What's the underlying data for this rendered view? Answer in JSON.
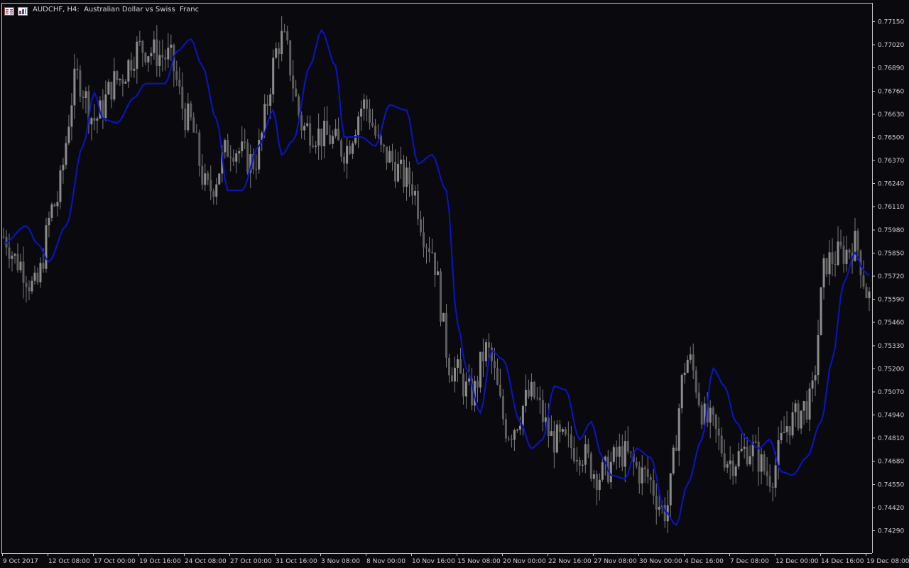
{
  "window": {
    "title": "AUDCHF, H4:  Australian Dollar vs Swiss  Franc",
    "icons": [
      "chart-window-icon",
      "chart-properties-icon"
    ]
  },
  "colors": {
    "background": "#0a0a0e",
    "candle": "#7a7a7a",
    "indicator": "#0a14c8",
    "axis": "#c8c8c8",
    "text": "#d0d0d0"
  },
  "chart_data": {
    "type": "line",
    "symbol": "AUDCHF",
    "timeframe": "H4",
    "description": "Australian Dollar vs Swiss  Franc",
    "price_axis_labels": [
      "0.77150",
      "0.77020",
      "0.76890",
      "0.76760",
      "0.76630",
      "0.76500",
      "0.76370",
      "0.76240",
      "0.76110",
      "0.75980",
      "0.75850",
      "0.75720",
      "0.75590",
      "0.75460",
      "0.75330",
      "0.75200",
      "0.75070",
      "0.74940",
      "0.74810",
      "0.74680",
      "0.74550",
      "0.74420",
      "0.74290"
    ],
    "time_axis_labels": [
      "9 Oct 2017",
      "12 Oct 08:00",
      "17 Oct 00:00",
      "19 Oct 16:00",
      "24 Oct 08:00",
      "27 Oct 00:00",
      "31 Oct 16:00",
      "3 Nov 08:00",
      "8 Nov 00:00",
      "10 Nov 16:00",
      "15 Nov 08:00",
      "20 Nov 00:00",
      "22 Nov 16:00",
      "27 Nov 08:00",
      "30 Nov 00:00",
      "4 Dec 16:00",
      "7 Dec 08:00",
      "12 Dec 00:00",
      "14 Dec 16:00",
      "19 Dec 08:00"
    ],
    "ylim": [
      0.7424,
      0.7722
    ],
    "price_keypoints": [
      {
        "t": 0,
        "p": 0.7594
      },
      {
        "t": 5,
        "p": 0.758
      },
      {
        "t": 11,
        "p": 0.7565
      },
      {
        "t": 18,
        "p": 0.7612
      },
      {
        "t": 26,
        "p": 0.7683
      },
      {
        "t": 32,
        "p": 0.766
      },
      {
        "t": 40,
        "p": 0.7682
      },
      {
        "t": 48,
        "p": 0.77
      },
      {
        "t": 58,
        "p": 0.7695
      },
      {
        "t": 65,
        "p": 0.766
      },
      {
        "t": 72,
        "p": 0.762
      },
      {
        "t": 80,
        "p": 0.7645
      },
      {
        "t": 88,
        "p": 0.7636
      },
      {
        "t": 98,
        "p": 0.7705
      },
      {
        "t": 106,
        "p": 0.7655
      },
      {
        "t": 114,
        "p": 0.765
      },
      {
        "t": 120,
        "p": 0.7643
      },
      {
        "t": 127,
        "p": 0.7668
      },
      {
        "t": 134,
        "p": 0.764
      },
      {
        "t": 143,
        "p": 0.7625
      },
      {
        "t": 150,
        "p": 0.759
      },
      {
        "t": 158,
        "p": 0.752
      },
      {
        "t": 165,
        "p": 0.7505
      },
      {
        "t": 170,
        "p": 0.753
      },
      {
        "t": 178,
        "p": 0.7485
      },
      {
        "t": 186,
        "p": 0.7505
      },
      {
        "t": 194,
        "p": 0.748
      },
      {
        "t": 202,
        "p": 0.7475
      },
      {
        "t": 210,
        "p": 0.746
      },
      {
        "t": 218,
        "p": 0.7472
      },
      {
        "t": 226,
        "p": 0.746
      },
      {
        "t": 233,
        "p": 0.744
      },
      {
        "t": 241,
        "p": 0.7525
      },
      {
        "t": 248,
        "p": 0.749
      },
      {
        "t": 256,
        "p": 0.7468
      },
      {
        "t": 263,
        "p": 0.7475
      },
      {
        "t": 270,
        "p": 0.746
      },
      {
        "t": 277,
        "p": 0.749
      },
      {
        "t": 284,
        "p": 0.75
      },
      {
        "t": 290,
        "p": 0.758
      },
      {
        "t": 296,
        "p": 0.7585
      },
      {
        "t": 300,
        "p": 0.759
      },
      {
        "t": 305,
        "p": 0.756
      }
    ],
    "indicator_keypoints": [
      {
        "t": 0,
        "p": 0.759
      },
      {
        "t": 8,
        "p": 0.76
      },
      {
        "t": 12,
        "p": 0.759
      },
      {
        "t": 16,
        "p": 0.758
      },
      {
        "t": 22,
        "p": 0.76
      },
      {
        "t": 28,
        "p": 0.7645
      },
      {
        "t": 32,
        "p": 0.7675
      },
      {
        "t": 35,
        "p": 0.766
      },
      {
        "t": 40,
        "p": 0.7658
      },
      {
        "t": 46,
        "p": 0.7672
      },
      {
        "t": 50,
        "p": 0.768
      },
      {
        "t": 57,
        "p": 0.768
      },
      {
        "t": 61,
        "p": 0.7698
      },
      {
        "t": 66,
        "p": 0.7705
      },
      {
        "t": 70,
        "p": 0.769
      },
      {
        "t": 75,
        "p": 0.766
      },
      {
        "t": 79,
        "p": 0.762
      },
      {
        "t": 84,
        "p": 0.762
      },
      {
        "t": 90,
        "p": 0.7645
      },
      {
        "t": 95,
        "p": 0.7665
      },
      {
        "t": 98,
        "p": 0.764
      },
      {
        "t": 102,
        "p": 0.7648
      },
      {
        "t": 108,
        "p": 0.769
      },
      {
        "t": 112,
        "p": 0.771
      },
      {
        "t": 117,
        "p": 0.769
      },
      {
        "t": 120,
        "p": 0.765
      },
      {
        "t": 126,
        "p": 0.765
      },
      {
        "t": 131,
        "p": 0.7645
      },
      {
        "t": 136,
        "p": 0.7668
      },
      {
        "t": 142,
        "p": 0.7665
      },
      {
        "t": 146,
        "p": 0.7635
      },
      {
        "t": 151,
        "p": 0.764
      },
      {
        "t": 156,
        "p": 0.762
      },
      {
        "t": 160,
        "p": 0.7545
      },
      {
        "t": 163,
        "p": 0.752
      },
      {
        "t": 168,
        "p": 0.7495
      },
      {
        "t": 172,
        "p": 0.753
      },
      {
        "t": 176,
        "p": 0.7525
      },
      {
        "t": 182,
        "p": 0.749
      },
      {
        "t": 186,
        "p": 0.7475
      },
      {
        "t": 190,
        "p": 0.748
      },
      {
        "t": 194,
        "p": 0.751
      },
      {
        "t": 198,
        "p": 0.7508
      },
      {
        "t": 203,
        "p": 0.748
      },
      {
        "t": 207,
        "p": 0.749
      },
      {
        "t": 211,
        "p": 0.747
      },
      {
        "t": 214,
        "p": 0.746
      },
      {
        "t": 219,
        "p": 0.7458
      },
      {
        "t": 223,
        "p": 0.7475
      },
      {
        "t": 228,
        "p": 0.747
      },
      {
        "t": 233,
        "p": 0.744
      },
      {
        "t": 237,
        "p": 0.7432
      },
      {
        "t": 241,
        "p": 0.7455
      },
      {
        "t": 246,
        "p": 0.748
      },
      {
        "t": 250,
        "p": 0.752
      },
      {
        "t": 254,
        "p": 0.751
      },
      {
        "t": 258,
        "p": 0.749
      },
      {
        "t": 262,
        "p": 0.748
      },
      {
        "t": 266,
        "p": 0.7475
      },
      {
        "t": 270,
        "p": 0.748
      },
      {
        "t": 274,
        "p": 0.7462
      },
      {
        "t": 278,
        "p": 0.746
      },
      {
        "t": 283,
        "p": 0.747
      },
      {
        "t": 288,
        "p": 0.749
      },
      {
        "t": 292,
        "p": 0.7525
      },
      {
        "t": 296,
        "p": 0.7568
      },
      {
        "t": 300,
        "p": 0.7585
      },
      {
        "t": 303,
        "p": 0.7575
      },
      {
        "t": 305,
        "p": 0.7572
      }
    ],
    "n_bars": 306,
    "grid": false,
    "legend": "none"
  }
}
